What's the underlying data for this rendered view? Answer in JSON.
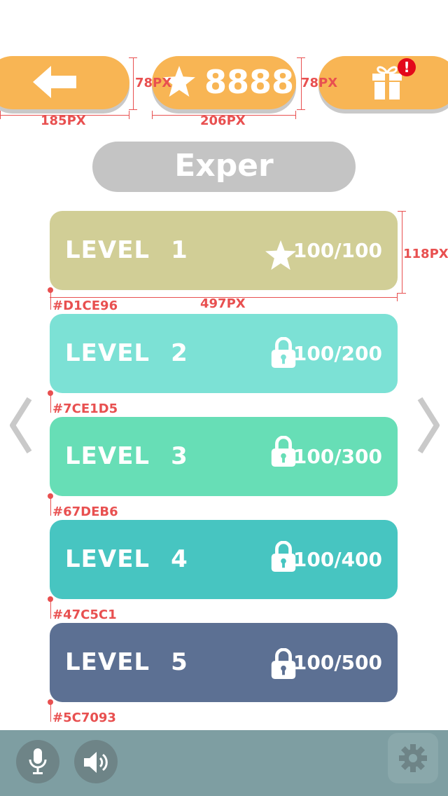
{
  "header": {
    "back_icon": "arrow-left-icon",
    "score_icon": "star-icon",
    "score": "8888",
    "gift_icon": "gift-icon",
    "gift_badge": "!",
    "accent_color": "#F8B554"
  },
  "annotations": {
    "button_height_left": "78PX",
    "button_height_right": "78PX",
    "back_width": "185PX",
    "score_width": "206PX",
    "card_width": "497PX",
    "card_height": "118PX"
  },
  "difficulty": {
    "label": "Exper",
    "color": "#C4C4C4"
  },
  "levels": [
    {
      "label": "LEVEL",
      "number": "1",
      "score": "100/100",
      "icon": "star-icon",
      "color": "#D1CE96",
      "hex": "#D1CE96"
    },
    {
      "label": "LEVEL",
      "number": "2",
      "score": "100/200",
      "icon": "lock-icon",
      "color": "#7CE1D5",
      "hex": "#7CE1D5"
    },
    {
      "label": "LEVEL",
      "number": "3",
      "score": "100/300",
      "icon": "lock-icon",
      "color": "#67DEB6",
      "hex": "#67DEB6"
    },
    {
      "label": "LEVEL",
      "number": "4",
      "score": "100/400",
      "icon": "lock-icon",
      "color": "#47C5C1",
      "hex": "#47C5C1"
    },
    {
      "label": "LEVEL",
      "number": "5",
      "score": "100/500",
      "icon": "lock-icon",
      "color": "#5C7093",
      "hex": "#5C7093"
    }
  ],
  "navigation": {
    "prev_icon": "chevron-left-icon",
    "next_icon": "chevron-right-icon"
  },
  "bottom_bar": {
    "mic_icon": "microphone-icon",
    "sound_icon": "speaker-icon",
    "settings_icon": "gear-icon",
    "color": "#7E9EA2"
  }
}
